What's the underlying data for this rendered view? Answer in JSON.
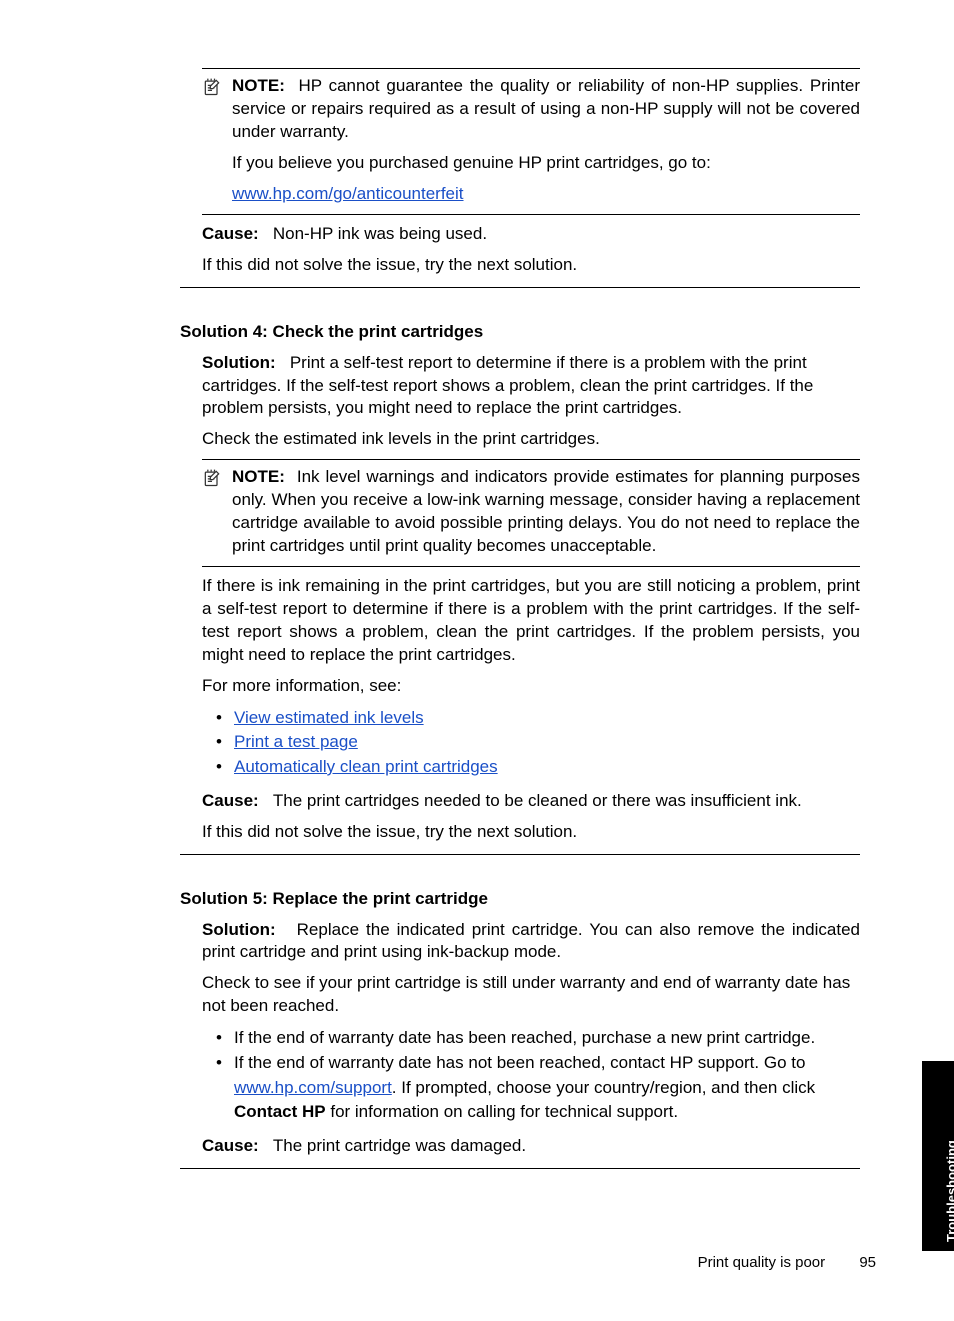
{
  "note1": {
    "label": "NOTE:",
    "text1": "HP cannot guarantee the quality or reliability of non-HP supplies. Printer service or repairs required as a result of using a non-HP supply will not be covered under warranty.",
    "text2": "If you believe you purchased genuine HP print cartridges, go to:",
    "link": "www.hp.com/go/anticounterfeit"
  },
  "cause1": {
    "label": "Cause:",
    "text": "Non-HP ink was being used."
  },
  "next1": "If this did not solve the issue, try the next solution.",
  "solution4": {
    "title": "Solution 4: Check the print cartridges",
    "solutionLabel": "Solution:",
    "solutionText": "Print a self-test report to determine if there is a problem with the print cartridges. If the self-test report shows a problem, clean the print cartridges. If the problem persists, you might need to replace the print cartridges.",
    "checkText": "Check the estimated ink levels in the print cartridges.",
    "note": {
      "label": "NOTE:",
      "text": "Ink level warnings and indicators provide estimates for planning purposes only. When you receive a low-ink warning message, consider having a replacement cartridge available to avoid possible printing delays. You do not need to replace the print cartridges until print quality becomes unacceptable."
    },
    "afterNote": "If there is ink remaining in the print cartridges, but you are still noticing a problem, print a self-test report to determine if there is a problem with the print cartridges. If the self-test report shows a problem, clean the print cartridges. If the problem persists, you might need to replace the print cartridges.",
    "moreInfo": "For more information, see:",
    "links": [
      "View estimated ink levels",
      "Print a test page",
      "Automatically clean print cartridges"
    ],
    "causeLabel": "Cause:",
    "causeText": "The print cartridges needed to be cleaned or there was insufficient ink.",
    "next": "If this did not solve the issue, try the next solution."
  },
  "solution5": {
    "title": "Solution 5: Replace the print cartridge",
    "solutionLabel": "Solution:",
    "solutionText": "Replace the indicated print cartridge. You can also remove the indicated print cartridge and print using ink-backup mode.",
    "checkText": "Check to see if your print cartridge is still under warranty and end of warranty date has not been reached.",
    "bullet1": "If the end of warranty date has been reached, purchase a new print cartridge.",
    "bullet2a": "If the end of warranty date has not been reached, contact HP support. Go to ",
    "bullet2link": "www.hp.com/support",
    "bullet2b": ". If prompted, choose your country/region, and then click ",
    "bullet2bold": "Contact HP",
    "bullet2c": " for information on calling for technical support.",
    "causeLabel": "Cause:",
    "causeText": "The print cartridge was damaged."
  },
  "sideTab": "Troubleshooting",
  "footer": {
    "section": "Print quality is poor",
    "page": "95"
  }
}
